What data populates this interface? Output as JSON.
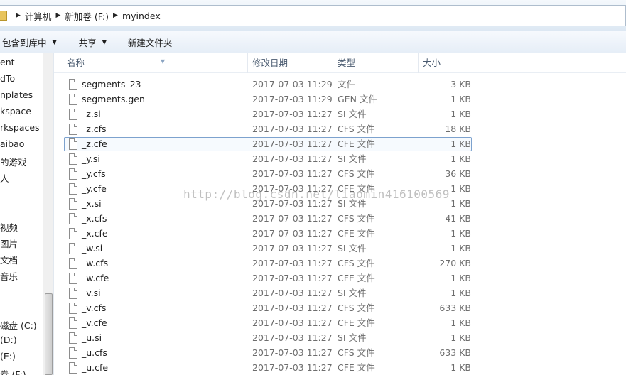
{
  "address": {
    "crumbs": [
      "计算机",
      "新加卷 (F:)",
      "myindex"
    ]
  },
  "toolbar": {
    "include_label": "包含到库中",
    "share_label": "共享",
    "new_folder_label": "新建文件夹"
  },
  "nav": {
    "items": [
      "ent",
      "dTo",
      "nplates",
      "kspace",
      "rkspaces",
      "aibao",
      "的游戏",
      "人",
      "",
      "",
      "视频",
      "图片",
      "文档",
      "音乐",
      "",
      "",
      "磁盘 (C:)",
      "(D:)",
      "(E:)",
      "卷 (F:)"
    ]
  },
  "columns": {
    "name": "名称",
    "date": "修改日期",
    "type": "类型",
    "size": "大小"
  },
  "files": [
    {
      "name": "segments_23",
      "date": "2017-07-03 11:29",
      "type": "文件",
      "size": "3 KB"
    },
    {
      "name": "segments.gen",
      "date": "2017-07-03 11:29",
      "type": "GEN 文件",
      "size": "1 KB"
    },
    {
      "name": "_z.si",
      "date": "2017-07-03 11:27",
      "type": "SI 文件",
      "size": "1 KB"
    },
    {
      "name": "_z.cfs",
      "date": "2017-07-03 11:27",
      "type": "CFS 文件",
      "size": "18 KB"
    },
    {
      "name": "_z.cfe",
      "date": "2017-07-03 11:27",
      "type": "CFE 文件",
      "size": "1 KB"
    },
    {
      "name": "_y.si",
      "date": "2017-07-03 11:27",
      "type": "SI 文件",
      "size": "1 KB"
    },
    {
      "name": "_y.cfs",
      "date": "2017-07-03 11:27",
      "type": "CFS 文件",
      "size": "36 KB"
    },
    {
      "name": "_y.cfe",
      "date": "2017-07-03 11:27",
      "type": "CFE 文件",
      "size": "1 KB"
    },
    {
      "name": "_x.si",
      "date": "2017-07-03 11:27",
      "type": "SI 文件",
      "size": "1 KB"
    },
    {
      "name": "_x.cfs",
      "date": "2017-07-03 11:27",
      "type": "CFS 文件",
      "size": "41 KB"
    },
    {
      "name": "_x.cfe",
      "date": "2017-07-03 11:27",
      "type": "CFE 文件",
      "size": "1 KB"
    },
    {
      "name": "_w.si",
      "date": "2017-07-03 11:27",
      "type": "SI 文件",
      "size": "1 KB"
    },
    {
      "name": "_w.cfs",
      "date": "2017-07-03 11:27",
      "type": "CFS 文件",
      "size": "270 KB"
    },
    {
      "name": "_w.cfe",
      "date": "2017-07-03 11:27",
      "type": "CFE 文件",
      "size": "1 KB"
    },
    {
      "name": "_v.si",
      "date": "2017-07-03 11:27",
      "type": "SI 文件",
      "size": "1 KB"
    },
    {
      "name": "_v.cfs",
      "date": "2017-07-03 11:27",
      "type": "CFS 文件",
      "size": "633 KB"
    },
    {
      "name": "_v.cfe",
      "date": "2017-07-03 11:27",
      "type": "CFE 文件",
      "size": "1 KB"
    },
    {
      "name": "_u.si",
      "date": "2017-07-03 11:27",
      "type": "SI 文件",
      "size": "1 KB"
    },
    {
      "name": "_u.cfs",
      "date": "2017-07-03 11:27",
      "type": "CFS 文件",
      "size": "633 KB"
    },
    {
      "name": "_u.cfe",
      "date": "2017-07-03 11:27",
      "type": "CFE 文件",
      "size": "1 KB"
    }
  ],
  "selected_index": 4,
  "watermark": "http://blog.csdn.net/liaomin416100569",
  "icons": {
    "folder": "folder-icon",
    "breadcrumb_separator": "chevron-right-icon",
    "dropdown": "chevron-down-icon",
    "file": "file-icon"
  }
}
